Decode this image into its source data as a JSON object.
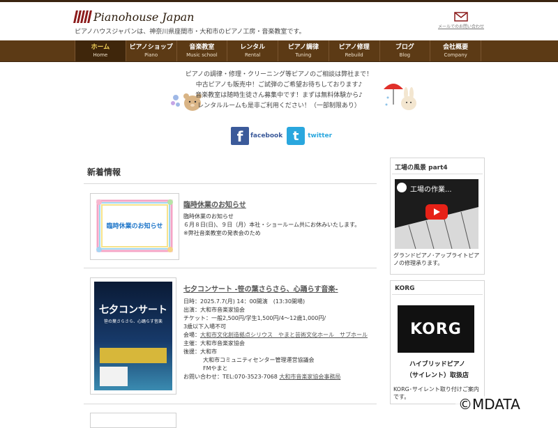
{
  "header": {
    "logo_text": "Pianohouse Japan",
    "tagline": "ピアノハウスジャパンは、神奈川県座間市・大和市のピアノ工房・音楽教室です。",
    "mail_label": "メールでのお問い合わせ"
  },
  "nav": [
    {
      "jp": "ホーム",
      "en": "Home"
    },
    {
      "jp": "ピアノショップ",
      "en": "Piano"
    },
    {
      "jp": "音楽教室",
      "en": "Music school"
    },
    {
      "jp": "レンタル",
      "en": "Rental"
    },
    {
      "jp": "ピアノ調律",
      "en": "Tuning"
    },
    {
      "jp": "ピアノ修理",
      "en": "Rebuild"
    },
    {
      "jp": "ブログ",
      "en": "Blog"
    },
    {
      "jp": "会社概要",
      "en": "Company"
    }
  ],
  "banner": {
    "lines": [
      "ピアノの調律・修理・クリーニング等ピアノのご相談は弊社まで！",
      "中古ピアノも販売中！ご試弾のご希望お待ちしております♪",
      "音楽教室は随時生徒さん募集中です！まずは無料体験から♪",
      "レンタルルームも是非ご利用ください！（一部制限あり）"
    ]
  },
  "social": {
    "facebook": "facebook",
    "twitter": "twitter"
  },
  "news": {
    "heading": "新着情報",
    "item1": {
      "thumb_text": "臨時休業のお知らせ",
      "title": "臨時休業のお知らせ",
      "lines": [
        "臨時休業のお知らせ",
        "６月８日(日)、９日（月）本社・ショールーム共にお休みいたします。",
        "※弊社音楽教室の発表会のため"
      ]
    },
    "item2": {
      "title": "七夕コンサート -笹の葉さらさら、心踊らす音楽-",
      "poster_title": "七夕コンサート",
      "poster_sub": "笹の葉さらさら、心踊らす音楽",
      "date": "日時：2025.7.7(月) 14：00開演　(13:30開場)",
      "performer": "出演：大和市音楽家協会",
      "ticket": "チケット：一般2,500円/学生1,500円/4～12歳1,000円/",
      "ticket2": "3歳以下入場不可",
      "venue_label": "会場：",
      "venue_link": "大和市文化創造拠点シリウス　やまと芸術文化ホール　サブホール",
      "organizer": "主催：大和市音楽家協会",
      "support1": "後援：大和市",
      "support2": "大和市コミュニティセンター管理運営協議会",
      "support3": "FMやまと",
      "contact_label": "お問い合わせ：TEL:070-3523-7068",
      "contact_link": "大和市音楽家協会事務局"
    }
  },
  "sidebar": {
    "factory": {
      "title": "工場の風景 part4",
      "video_title": "工場の作業...",
      "caption": "グランドピアノ･アップライトピアノの修理承ります。"
    },
    "korg": {
      "title": "KORG",
      "logo": "KORG",
      "sub1": "ハイブリッドピアノ",
      "sub2": "（サイレント）取扱店",
      "caption": "KORG･サイレント取り付けご案内です。"
    }
  },
  "copyright": "©MDATA",
  "colors": {
    "nav_bg": "#5c3a15",
    "nav_active": "#3f260b",
    "facebook": "#3b5a9a",
    "twitter": "#2aa7de"
  }
}
